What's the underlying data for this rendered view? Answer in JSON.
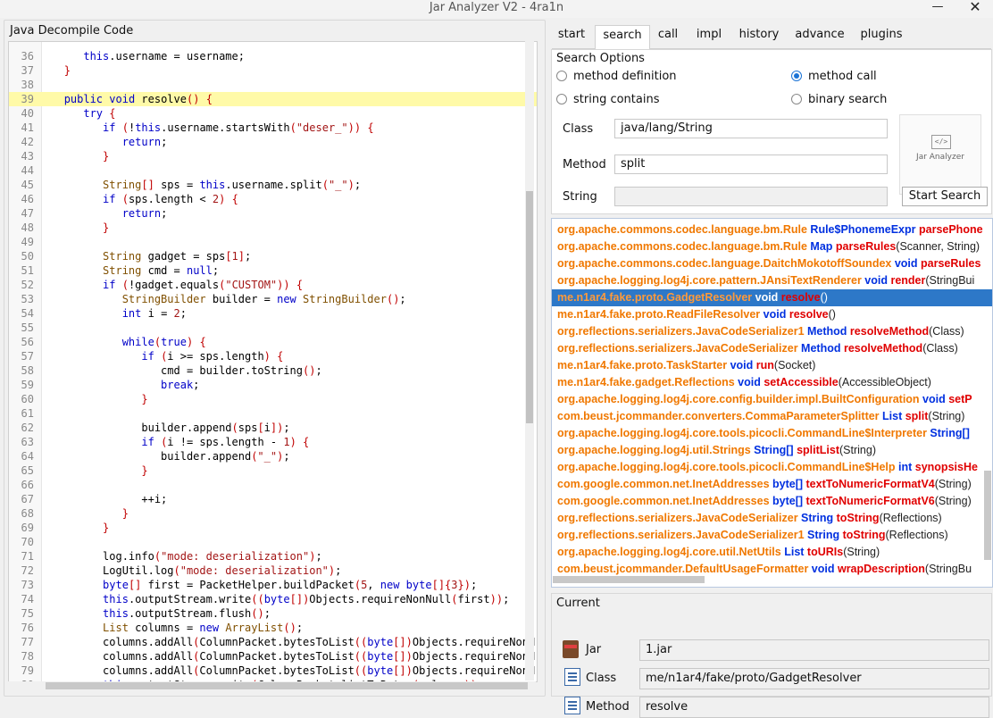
{
  "window": {
    "title": "Jar Analyzer V2 - 4ra1n",
    "minimize": "—",
    "close": "✕"
  },
  "left": {
    "title": "Java Decompile Code",
    "lines": [
      {
        "n": "36",
        "t": "      this.username = username;"
      },
      {
        "n": "37",
        "t": "   }"
      },
      {
        "n": "38",
        "t": ""
      },
      {
        "n": "39",
        "t": "   public void resolve() {"
      },
      {
        "n": "40",
        "t": "      try {"
      },
      {
        "n": "41",
        "t": "         if (!this.username.startsWith(\"deser_\")) {"
      },
      {
        "n": "42",
        "t": "            return;"
      },
      {
        "n": "43",
        "t": "         }"
      },
      {
        "n": "44",
        "t": ""
      },
      {
        "n": "45",
        "t": "         String[] sps = this.username.split(\"_\");"
      },
      {
        "n": "46",
        "t": "         if (sps.length < 2) {"
      },
      {
        "n": "47",
        "t": "            return;"
      },
      {
        "n": "48",
        "t": "         }"
      },
      {
        "n": "49",
        "t": ""
      },
      {
        "n": "50",
        "t": "         String gadget = sps[1];"
      },
      {
        "n": "51",
        "t": "         String cmd = null;"
      },
      {
        "n": "52",
        "t": "         if (!gadget.equals(\"CUSTOM\")) {"
      },
      {
        "n": "53",
        "t": "            StringBuilder builder = new StringBuilder();"
      },
      {
        "n": "54",
        "t": "            int i = 2;"
      },
      {
        "n": "55",
        "t": ""
      },
      {
        "n": "56",
        "t": "            while(true) {"
      },
      {
        "n": "57",
        "t": "               if (i >= sps.length) {"
      },
      {
        "n": "58",
        "t": "                  cmd = builder.toString();"
      },
      {
        "n": "59",
        "t": "                  break;"
      },
      {
        "n": "60",
        "t": "               }"
      },
      {
        "n": "61",
        "t": ""
      },
      {
        "n": "62",
        "t": "               builder.append(sps[i]);"
      },
      {
        "n": "63",
        "t": "               if (i != sps.length - 1) {"
      },
      {
        "n": "64",
        "t": "                  builder.append(\"_\");"
      },
      {
        "n": "65",
        "t": "               }"
      },
      {
        "n": "66",
        "t": ""
      },
      {
        "n": "67",
        "t": "               ++i;"
      },
      {
        "n": "68",
        "t": "            }"
      },
      {
        "n": "69",
        "t": "         }"
      },
      {
        "n": "70",
        "t": ""
      },
      {
        "n": "71",
        "t": "         log.info(\"mode: deserialization\");"
      },
      {
        "n": "72",
        "t": "         LogUtil.log(\"mode: deserialization\");"
      },
      {
        "n": "73",
        "t": "         byte[] first = PacketHelper.buildPacket(5, new byte[]{3});"
      },
      {
        "n": "74",
        "t": "         this.outputStream.write((byte[])Objects.requireNonNull(first));"
      },
      {
        "n": "75",
        "t": "         this.outputStream.flush();"
      },
      {
        "n": "76",
        "t": "         List columns = new ArrayList();"
      },
      {
        "n": "77",
        "t": "         columns.addAll(ColumnPacket.bytesToList((byte[])Objects.requireNonN"
      },
      {
        "n": "78",
        "t": "         columns.addAll(ColumnPacket.bytesToList((byte[])Objects.requireNonN"
      },
      {
        "n": "79",
        "t": "         columns.addAll(ColumnPacket.bytesToList((byte[])Objects.requireNonN"
      },
      {
        "n": "80",
        "t": "         this.outputStream.write(ColumnPacket.listToBytes(columns));"
      }
    ]
  },
  "tabs": [
    "start",
    "search",
    "call",
    "impl",
    "history",
    "advance",
    "plugins"
  ],
  "search": {
    "group_label": "Search Options",
    "radios": [
      "method definition",
      "method call",
      "string contains",
      "binary search"
    ],
    "selected": "method call",
    "class_label": "Class",
    "class_value": "java/lang/String",
    "method_label": "Method",
    "method_value": "split",
    "string_label": "String",
    "string_value": "",
    "logo_text": "Jar Analyzer",
    "logo_glyph": "</>",
    "button": "Start Search"
  },
  "results": [
    {
      "c": "org.apache.commons.codec.language.bm.Rule",
      "t": "Rule$PhonemeExpr",
      "m": "parsePhone",
      "a": ""
    },
    {
      "c": "org.apache.commons.codec.language.bm.Rule",
      "t": "Map",
      "m": "parseRules",
      "a": "(Scanner, String)"
    },
    {
      "c": "org.apache.commons.codec.language.DaitchMokotoffSoundex",
      "t": "void",
      "m": "parseRules",
      "a": ""
    },
    {
      "c": "org.apache.logging.log4j.core.pattern.JAnsiTextRenderer",
      "t": "void",
      "m": "render",
      "a": "(StringBui"
    },
    {
      "c": "me.n1ar4.fake.proto.GadgetResolver",
      "t": "void",
      "m": "resolve",
      "a": "()"
    },
    {
      "c": "me.n1ar4.fake.proto.ReadFileResolver",
      "t": "void",
      "m": "resolve",
      "a": "()"
    },
    {
      "c": "org.reflections.serializers.JavaCodeSerializer1",
      "t": "Method",
      "m": "resolveMethod",
      "a": "(Class)"
    },
    {
      "c": "org.reflections.serializers.JavaCodeSerializer",
      "t": "Method",
      "m": "resolveMethod",
      "a": "(Class)"
    },
    {
      "c": "me.n1ar4.fake.proto.TaskStarter",
      "t": "void",
      "m": "run",
      "a": "(Socket)"
    },
    {
      "c": "me.n1ar4.fake.gadget.Reflections",
      "t": "void",
      "m": "setAccessible",
      "a": "(AccessibleObject)"
    },
    {
      "c": "org.apache.logging.log4j.core.config.builder.impl.BuiltConfiguration",
      "t": "void",
      "m": "setP",
      "a": ""
    },
    {
      "c": "com.beust.jcommander.converters.CommaParameterSplitter",
      "t": "List",
      "m": "split",
      "a": "(String)"
    },
    {
      "c": "org.apache.logging.log4j.core.tools.picocli.CommandLine$Interpreter",
      "t": "String[]",
      "m": "",
      "a": ""
    },
    {
      "c": "org.apache.logging.log4j.util.Strings",
      "t": "String[]",
      "m": "splitList",
      "a": "(String)"
    },
    {
      "c": "org.apache.logging.log4j.core.tools.picocli.CommandLine$Help",
      "t": "int",
      "m": "synopsisHe",
      "a": ""
    },
    {
      "c": "com.google.common.net.InetAddresses",
      "t": "byte[]",
      "m": "textToNumericFormatV4",
      "a": "(String)"
    },
    {
      "c": "com.google.common.net.InetAddresses",
      "t": "byte[]",
      "m": "textToNumericFormatV6",
      "a": "(String)"
    },
    {
      "c": "org.reflections.serializers.JavaCodeSerializer",
      "t": "String",
      "m": "toString",
      "a": "(Reflections)"
    },
    {
      "c": "org.reflections.serializers.JavaCodeSerializer1",
      "t": "String",
      "m": "toString",
      "a": "(Reflections)"
    },
    {
      "c": "org.apache.logging.log4j.core.util.NetUtils",
      "t": "List",
      "m": "toURIs",
      "a": "(String)"
    },
    {
      "c": "com.beust.jcommander.DefaultUsageFormatter",
      "t": "void",
      "m": "wrapDescription",
      "a": "(StringBu"
    }
  ],
  "selected_result": 4,
  "current": {
    "title": "Current",
    "jar_label": "Jar",
    "jar_value": "1.jar",
    "class_label": "Class",
    "class_value": "me/n1ar4/fake/proto/GadgetResolver",
    "method_label": "Method",
    "method_value": "resolve"
  }
}
